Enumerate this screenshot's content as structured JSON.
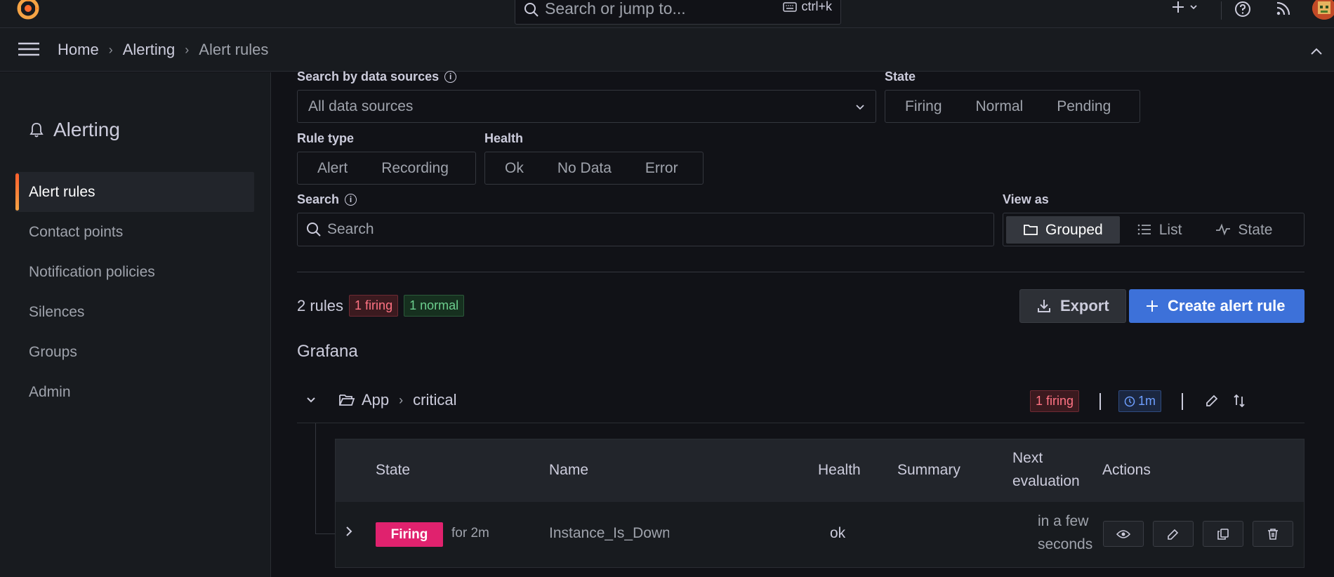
{
  "topbar": {
    "search_placeholder": "Search or jump to...",
    "shortcut": "ctrl+k",
    "plus_icon": "plus-icon",
    "help_icon": "help-icon",
    "news_icon": "rss-icon"
  },
  "breadcrumb": {
    "items": [
      "Home",
      "Alerting",
      "Alert rules"
    ]
  },
  "sidebar": {
    "title": "Alerting",
    "items": [
      {
        "label": "Alert rules",
        "active": true
      },
      {
        "label": "Contact points"
      },
      {
        "label": "Notification policies"
      },
      {
        "label": "Silences"
      },
      {
        "label": "Groups"
      },
      {
        "label": "Admin"
      }
    ]
  },
  "filters": {
    "datasources_label": "Search by data sources",
    "datasources_value": "All data sources",
    "state_label": "State",
    "state_options": [
      "Firing",
      "Normal",
      "Pending"
    ],
    "ruletype_label": "Rule type",
    "ruletype_options": [
      "Alert",
      "Recording"
    ],
    "health_label": "Health",
    "health_options": [
      "Ok",
      "No Data",
      "Error"
    ],
    "search_label": "Search",
    "search_placeholder": "Search",
    "viewas_label": "View as",
    "viewas_options": [
      "Grouped",
      "List",
      "State"
    ],
    "viewas_selected": "Grouped"
  },
  "summary": {
    "count": "2 rules",
    "firing": "1 firing",
    "normal": "1 normal"
  },
  "actions": {
    "export": "Export",
    "create": "Create alert rule"
  },
  "group": {
    "datasource": "Grafana",
    "folder": "App",
    "name": "critical",
    "firing_badge": "1 firing",
    "interval": "1m"
  },
  "table": {
    "headers": {
      "state": "State",
      "name": "Name",
      "health": "Health",
      "summary": "Summary",
      "next_line1": "Next",
      "next_line2": "evaluation",
      "actions": "Actions"
    },
    "rows": [
      {
        "state": "Firing",
        "for": "for 2m",
        "name": "Instance_Is_Down",
        "health": "ok",
        "summary": "",
        "next_line1": "in a few",
        "next_line2": "seconds"
      }
    ]
  },
  "colors": {
    "accent_blue": "#3d71d9",
    "firing": "#e0226e",
    "active_bar": "#ff5f2c"
  }
}
